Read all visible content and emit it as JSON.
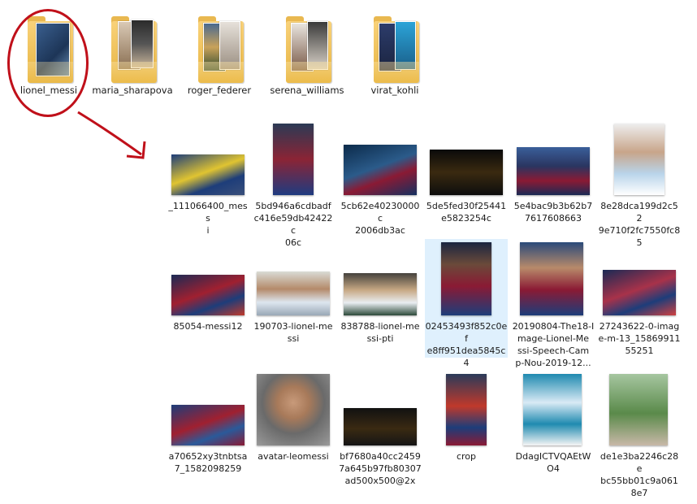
{
  "folders": [
    {
      "name": "lionel_messi"
    },
    {
      "name": "maria_sharapova"
    },
    {
      "name": "roger_federer"
    },
    {
      "name": "serena_williams"
    },
    {
      "name": "virat_kohli"
    }
  ],
  "files": [
    {
      "lines": [
        "_111066400_mess",
        "i"
      ]
    },
    {
      "lines": [
        "5bd946a6cdbadf",
        "c416e59db42422c",
        "06c"
      ]
    },
    {
      "lines": [
        "5cb62e40230000c",
        "2006db3ac"
      ]
    },
    {
      "lines": [
        "5de5fed30f25441",
        "e5823254c"
      ]
    },
    {
      "lines": [
        "5e4bac9b3b62b7",
        "7617608663"
      ]
    },
    {
      "lines": [
        "8e28dca199d2c52",
        "9e710f2fc7550fc8",
        "5"
      ]
    },
    {
      "lines": [
        "85054-messi12"
      ]
    },
    {
      "lines": [
        "190703-lionel-me",
        "ssi"
      ]
    },
    {
      "lines": [
        "838788-lionel-me",
        "ssi-pti"
      ]
    },
    {
      "lines": [
        "02453493f852c0ef",
        "e8ff951dea5845c",
        "4"
      ]
    },
    {
      "lines": [
        "20190804-The18-I",
        "mage-Lionel-Me",
        "ssi-Speech-Cam",
        "p-Nou-2019-12..."
      ]
    },
    {
      "lines": [
        "27243622-0-imag",
        "e-m-13_15869911",
        "55251"
      ]
    },
    {
      "lines": [
        "a70652xy3tnbtsa",
        "7_1582098259"
      ]
    },
    {
      "lines": [
        "avatar-leomessi"
      ]
    },
    {
      "lines": [
        "bf7680a40cc2459",
        "7a645b97fb80307",
        "ad500x500@2x"
      ]
    },
    {
      "lines": [
        "crop"
      ]
    },
    {
      "lines": [
        "DdagICTVQAEtW",
        "O4"
      ]
    },
    {
      "lines": [
        "de1e3ba2246c28e",
        "bc55bb01c9a061",
        "8e7"
      ]
    }
  ],
  "annotation": {
    "color": "#c0101a"
  }
}
